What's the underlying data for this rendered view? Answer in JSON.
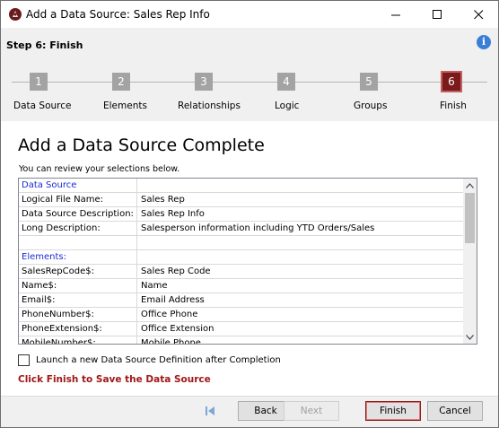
{
  "window": {
    "title": "Add a Data Source: Sales Rep Info",
    "icon": "crystal-app-icon"
  },
  "header": {
    "step_title": "Step 6: Finish",
    "steps": [
      {
        "number": "1",
        "label": "Data Source"
      },
      {
        "number": "2",
        "label": "Elements"
      },
      {
        "number": "3",
        "label": "Relationships"
      },
      {
        "number": "4",
        "label": "Logic"
      },
      {
        "number": "5",
        "label": "Groups"
      },
      {
        "number": "6",
        "label": "Finish"
      }
    ],
    "active_step": 6
  },
  "main": {
    "heading": "Add a Data Source Complete",
    "review_text": "You can review your selections below.",
    "grid_rows": [
      {
        "a": "Data Source",
        "b": "",
        "section": true
      },
      {
        "a": "Logical File Name:",
        "b": "Sales Rep"
      },
      {
        "a": "Data Source Description:",
        "b": "Sales Rep Info"
      },
      {
        "a": "Long Description:",
        "b": "Salesperson information including YTD Orders/Sales"
      },
      {
        "a": "",
        "b": ""
      },
      {
        "a": "Elements:",
        "b": "",
        "section": true
      },
      {
        "a": "SalesRepCode$:",
        "b": "Sales Rep Code"
      },
      {
        "a": "Name$:",
        "b": "Name"
      },
      {
        "a": "Email$:",
        "b": "Email Address"
      },
      {
        "a": "PhoneNumber$:",
        "b": "Office Phone"
      },
      {
        "a": "PhoneExtension$:",
        "b": "Office Extension"
      },
      {
        "a": "MobileNumber$:",
        "b": "Mobile Phone"
      }
    ],
    "launch_label": "Launch a new Data Source Definition after Completion",
    "launch_checked": false,
    "finish_hint": "Click Finish to Save the Data Source"
  },
  "footer": {
    "back_label": "Back",
    "next_label": "Next",
    "finish_label": "Finish",
    "cancel_label": "Cancel"
  },
  "colors": {
    "section_label": "#1c2bd6",
    "active_step": "#7a1a1a",
    "finish_hint": "#a01818",
    "inactive_step": "#a3a3a3"
  }
}
